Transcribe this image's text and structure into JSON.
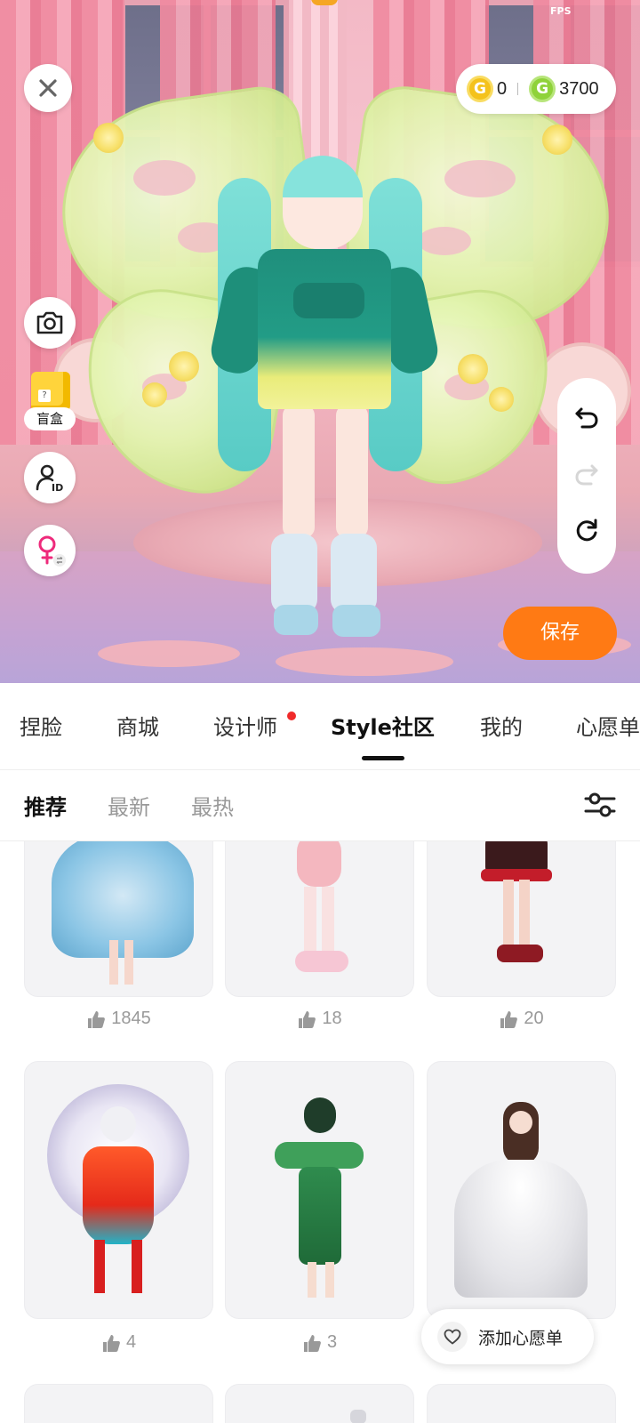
{
  "status": {
    "fps_label": "FPS"
  },
  "currency": {
    "gold_value": "0",
    "green_value": "3700"
  },
  "side_buttons": {
    "blindbox_label": "盲盒"
  },
  "actions": {
    "save_label": "保存"
  },
  "main_tabs": [
    {
      "label": "捏脸"
    },
    {
      "label": "商城"
    },
    {
      "label": "设计师",
      "has_dot": true
    },
    {
      "label": "Style社区",
      "active": true
    },
    {
      "label": "我的"
    },
    {
      "label": "心愿单"
    }
  ],
  "sub_tabs": [
    {
      "label": "推荐",
      "active": true
    },
    {
      "label": "最新"
    },
    {
      "label": "最热"
    }
  ],
  "cards": [
    {
      "likes": "1845"
    },
    {
      "likes": "18"
    },
    {
      "likes": "20"
    },
    {
      "likes": "4"
    },
    {
      "likes": "3"
    }
  ],
  "wishlist": {
    "add_label": "添加心愿单"
  },
  "colors": {
    "accent": "#ff7a14",
    "notification_dot": "#f02a2a",
    "gold_coin": "#f4c21c",
    "green_coin": "#8fd23a"
  },
  "icons": [
    "close-icon",
    "gold-coin-icon",
    "green-coin-icon",
    "camera-icon",
    "blindbox-icon",
    "id-card-icon",
    "female-gender-icon",
    "undo-icon",
    "redo-icon",
    "reset-icon",
    "filter-icon",
    "thumbs-up-icon",
    "heart-icon"
  ]
}
